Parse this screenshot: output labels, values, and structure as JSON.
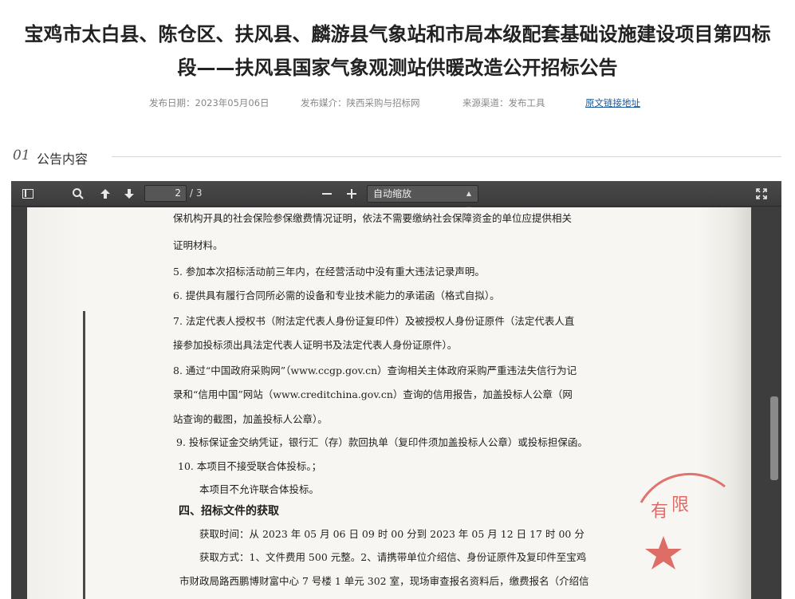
{
  "article": {
    "title_line1": "宝鸡市太白县、陈仓区、扶风县、麟游县气象站和市局本级配套基础设施建设项目第四标",
    "title_line2": "段——扶风县国家气象观测站供暖改造公开招标公告",
    "publish_date": "发布日期：2023年05月06日",
    "publish_media": "发布媒介：陕西采购与招标网",
    "source_channel": "来源渠道：发布工具",
    "original_link": "原文链接地址"
  },
  "section": {
    "number": "01",
    "label": "公告内容"
  },
  "viewer": {
    "page_current": "2",
    "page_total": "/ 3",
    "zoom_label": "自动缩放",
    "icons": {
      "sidebar": "sidebar-toggle-icon",
      "search": "search-icon",
      "prev": "arrow-up-icon",
      "next": "arrow-down-icon",
      "zoom_out": "minus-icon",
      "zoom_in": "plus-icon",
      "fullscreen": "fullscreen-icon"
    }
  },
  "document": {
    "lines": [
      "保机构开具的社会保险参保缴费情况证明，依法不需要缴纳社会保障资金的单位应提供相关",
      "证明材料。",
      "5. 参加本次招标活动前三年内，在经营活动中没有重大违法记录声明。",
      "6. 提供具有履行合同所必需的设备和专业技术能力的承诺函（格式自拟）。",
      "7. 法定代表人授权书（附法定代表人身份证复印件）及被授权人身份证原件（法定代表人直",
      "接参加投标须出具法定代表人证明书及法定代表人身份证原件）。",
      "8. 通过“中国政府采购网”（www.ccgp.gov.cn）查询相关主体政府采购严重违法失信行为记",
      "录和“信用中国”网站（www.creditchina.gov.cn）查询的信用报告，加盖投标人公章（网",
      "站查询的截图，加盖投标人公章）。",
      "9. 投标保证金交纳凭证，银行汇（存）款回执单（复印件须加盖投标人公章）或投标担保函。",
      "10. 本项目不接受联合体投标。；",
      "本项目不允许联合体投标。",
      "四、招标文件的获取",
      "获取时间：从 2023 年 05 月 06 日  09 时 00 分到 2023 年 05 月 12 日  17 时 00 分",
      "获取方式：1、文件费用 500 元整。2、请携带单位介绍信、身份证原件及复印件至宝鸡",
      "市财政局路西鹏博财富中心 7 号楼 1 单元 302 室，现场审查报名资料后，缴费报名（介绍信"
    ],
    "seal_text": "有限",
    "colors": {
      "seal": "#d9534f"
    }
  }
}
